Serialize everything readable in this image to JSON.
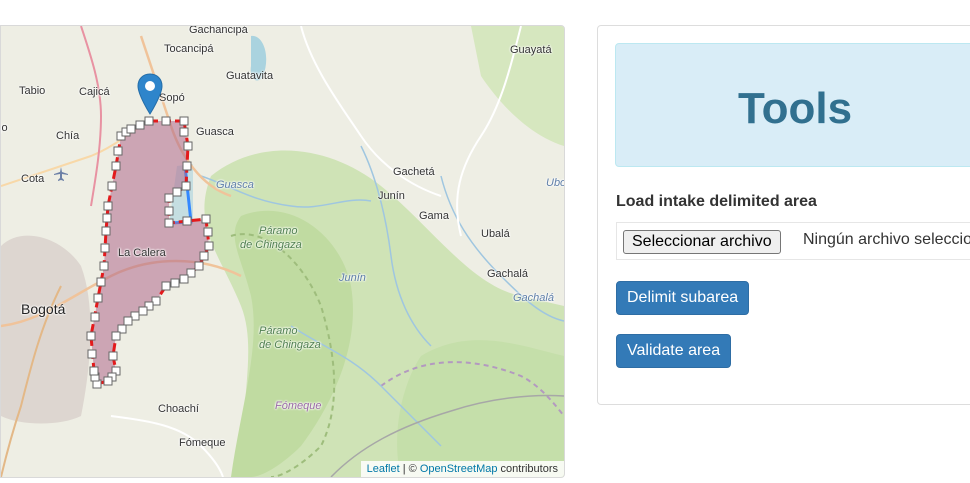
{
  "map": {
    "places": {
      "gachancipa": "Gachancipá",
      "tocancipa": "Tocancipá",
      "guayata": "Guayatá",
      "guatavita": "Guatavita",
      "tabio": "Tabio",
      "cajica": "Cajicá",
      "sopo": "Sopó",
      "guasca": "Guasca",
      "chia": "Chía",
      "cota": "Cota",
      "guasca_river": "Guasca",
      "gacheta": "Gachetá",
      "ubo": "Ubo",
      "junin_town": "Junín",
      "gama": "Gama",
      "paramo1": "Páramo",
      "chingaza1": "de Chingaza",
      "la_calera": "La Calera",
      "ubala": "Ubalá",
      "junin_river": "Junín",
      "bogota": "Bogotá",
      "gachala": "Gachalá",
      "gachala_river": "Gachalá",
      "paramo2": "Páramo",
      "chingaza2": "de Chingaza",
      "choachi": "Choachí",
      "fomeque_river": "Fómeque",
      "fomeque": "Fómeque",
      "jo": "jo"
    },
    "attribution": {
      "leaflet": "Leaflet",
      "sep": " | © ",
      "osm": "OpenStreetMap",
      "contributors": " contributors"
    },
    "polygon_color": "#e31a1c",
    "polygon_fill": "#b06a8c",
    "line_color": "#3388ff",
    "marker_icon": "map-marker-icon"
  },
  "tools": {
    "title": "Tools",
    "load_label": "Load intake delimited area",
    "file_button": "Seleccionar archivo",
    "file_status": "Ningún archivo seleccionado",
    "delimit_button": "Delimit subarea",
    "validate_button": "Validate area"
  },
  "colors": {
    "primary": "#337ab7",
    "jumbotron": "#d9edf7",
    "title": "#31708f"
  }
}
